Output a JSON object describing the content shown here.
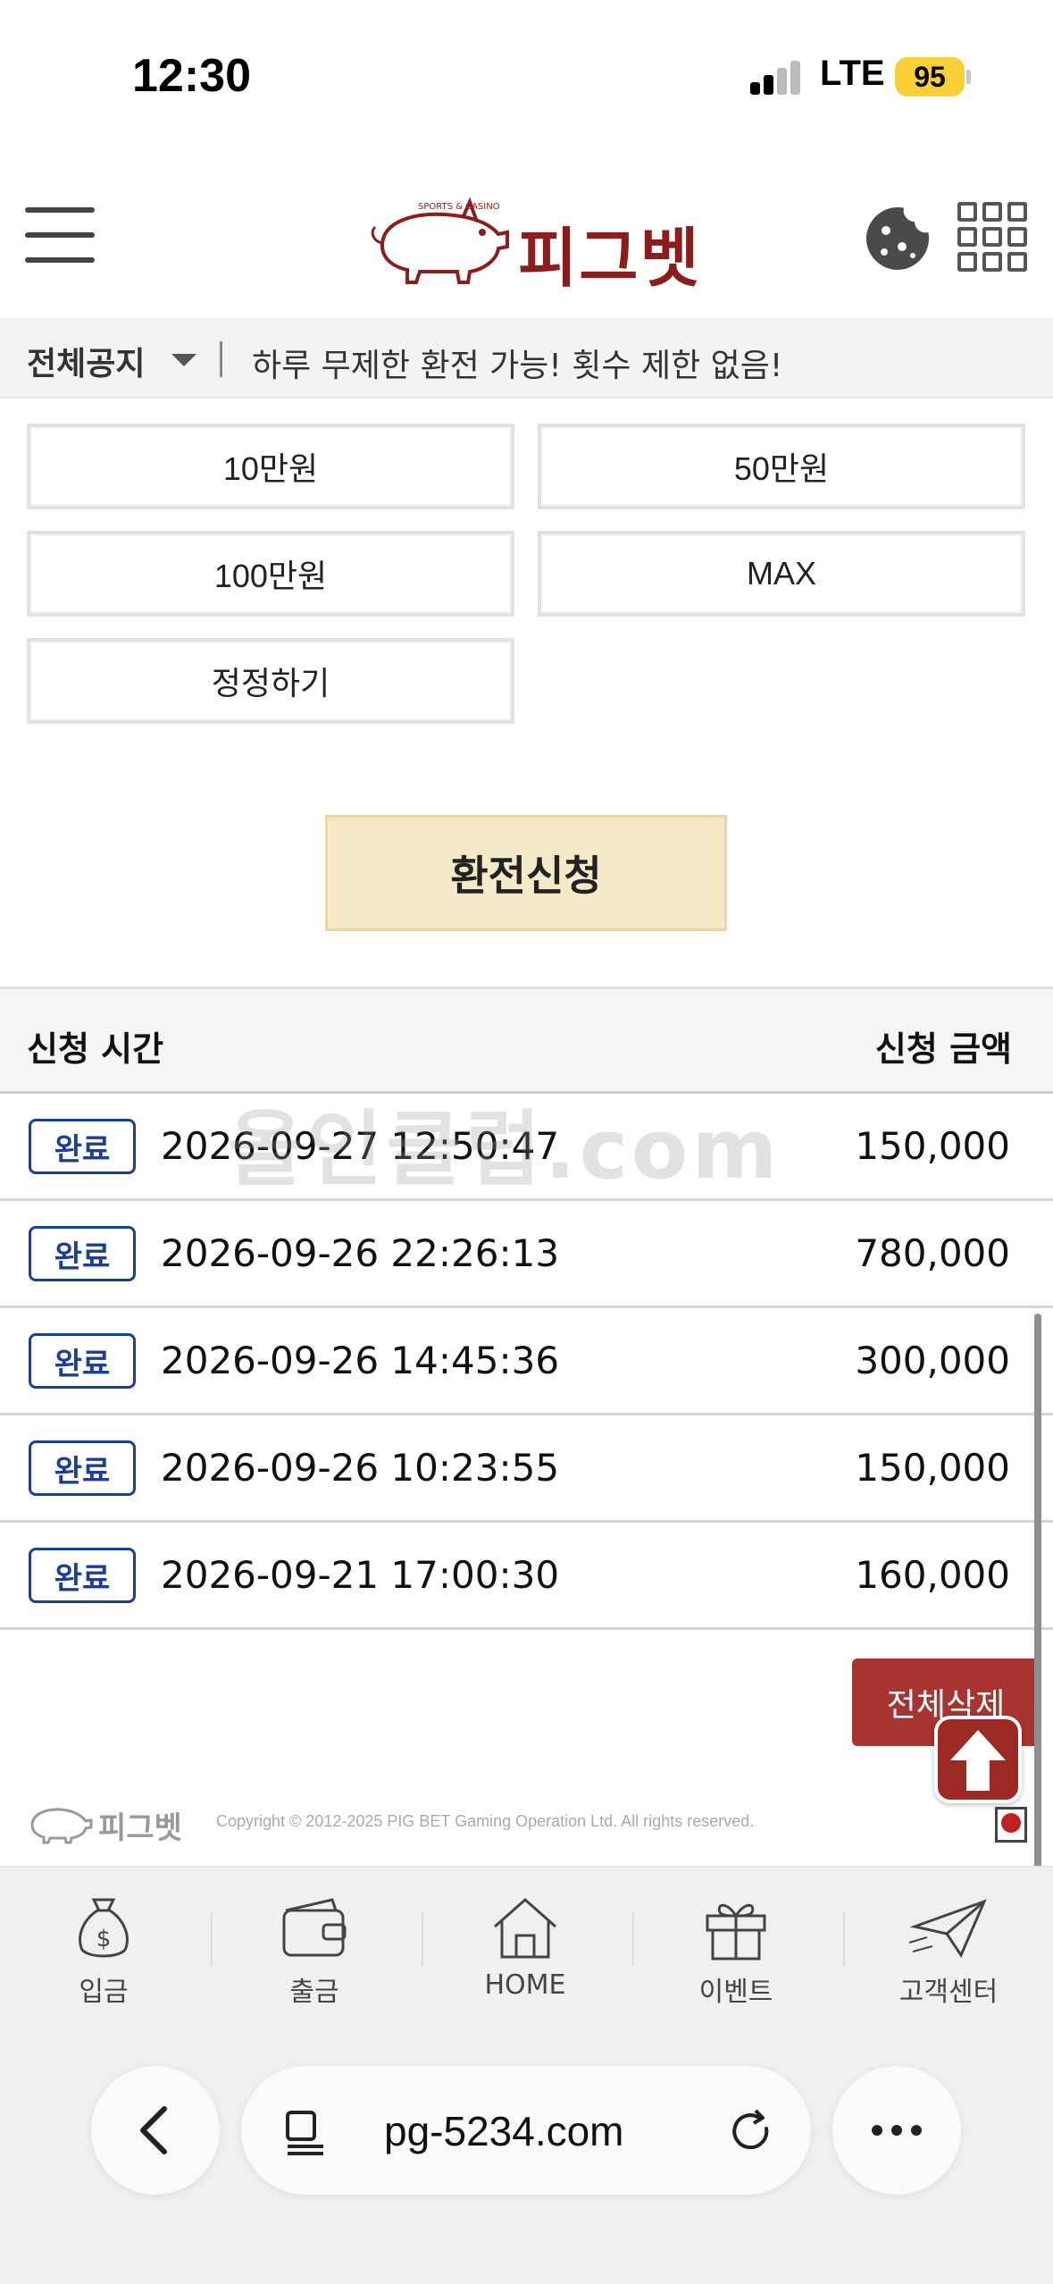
{
  "status_bar": {
    "time": "12:30",
    "network": "LTE",
    "battery": "95"
  },
  "header": {
    "logo_text": "피그벳",
    "logo_tagline": "SPORTS & CASINO"
  },
  "notice": {
    "category": "전체공지",
    "text": "하루 무제한 환전 가능! 횟수 제한 없음!"
  },
  "amount_buttons": [
    "10만원",
    "50만원",
    "100만원",
    "MAX",
    "정정하기"
  ],
  "submit_label": "환전신청",
  "table": {
    "headers": {
      "time": "신청 시간",
      "amount": "신청 금액"
    },
    "rows": [
      {
        "status": "완료",
        "time": "2026-09-27 12:50:47",
        "amount": "150,000"
      },
      {
        "status": "완료",
        "time": "2026-09-26 22:26:13",
        "amount": "780,000"
      },
      {
        "status": "완료",
        "time": "2026-09-26 14:45:36",
        "amount": "300,000"
      },
      {
        "status": "완료",
        "time": "2026-09-26 10:23:55",
        "amount": "150,000"
      },
      {
        "status": "완료",
        "time": "2026-09-21 17:00:30",
        "amount": "160,000"
      }
    ]
  },
  "watermark": "올인클럽.com",
  "delete_all_label": "전체삭제",
  "footer": {
    "logo_text": "피그벳",
    "copyright": "Copyright © 2012-2025 PIG BET Gaming Operation Ltd. All rights reserved."
  },
  "bottom_nav": [
    {
      "label": "입금",
      "icon": "money-bag-icon"
    },
    {
      "label": "출금",
      "icon": "wallet-icon"
    },
    {
      "label": "HOME",
      "icon": "home-icon"
    },
    {
      "label": "이벤트",
      "icon": "gift-icon"
    },
    {
      "label": "고객센터",
      "icon": "paper-plane-icon"
    }
  ],
  "browser": {
    "url": "pg-5234.com"
  },
  "colors": {
    "brand": "#8b1d1d",
    "badge": "#1c3f91",
    "submit_bg": "#f5e9c8",
    "delete_bg": "#a73430"
  }
}
